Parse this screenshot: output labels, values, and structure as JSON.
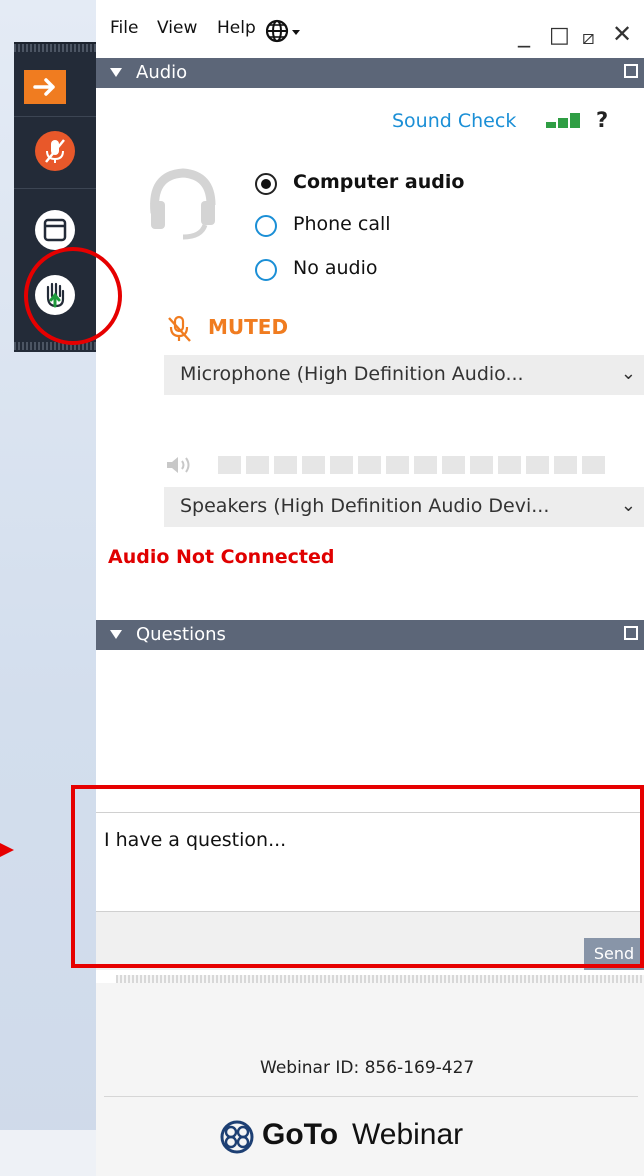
{
  "menubar": {
    "items": [
      "File",
      "View",
      "Help"
    ],
    "globe_icon": "globe-icon"
  },
  "window_controls": {
    "minimize": "_",
    "maximize": "□",
    "popout": "⧄",
    "close": "✕"
  },
  "toolbar": {
    "buttons": [
      {
        "name": "collapse-arrow",
        "icon": "arrow-right-icon",
        "color": "#f07c20"
      },
      {
        "name": "microphone-muted",
        "icon": "mic-off-icon",
        "color": "#e8582a"
      },
      {
        "name": "screen-viewer",
        "icon": "window-icon",
        "color": "#ffffff"
      },
      {
        "name": "raise-hand",
        "icon": "hand-icon",
        "color": "#ffffff"
      }
    ]
  },
  "audio": {
    "header": "Audio",
    "sound_check": "Sound Check",
    "help": "?",
    "options": [
      {
        "label": "Computer audio",
        "selected": true
      },
      {
        "label": "Phone call",
        "selected": false
      },
      {
        "label": "No audio",
        "selected": false
      }
    ],
    "muted_label": "MUTED",
    "microphone_device": "Microphone (High Definition Audio...",
    "speaker_device": "Speakers (High Definition Audio Devi...",
    "status": "Audio Not Connected",
    "accent_color": "#f07c20",
    "status_color": "#e00000"
  },
  "questions": {
    "header": "Questions",
    "input_placeholder": "I have a question...",
    "send_label": "Send"
  },
  "footer": {
    "webinar_id": "Webinar ID: 856-169-427",
    "brand_goto": "GoTo",
    "brand_webinar": "Webinar"
  }
}
